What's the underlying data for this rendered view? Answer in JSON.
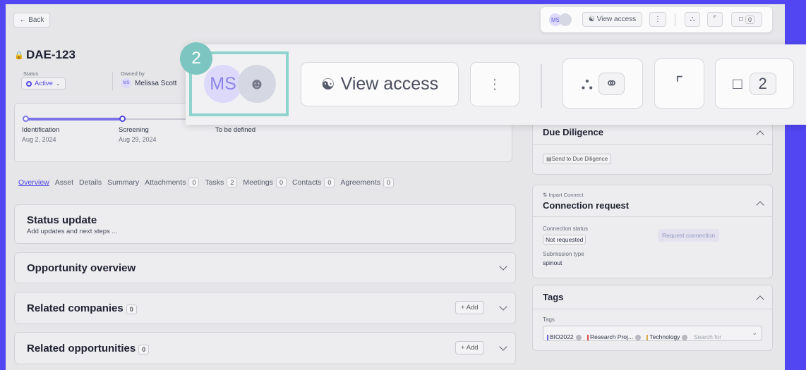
{
  "toolbar": {
    "back_label": "← Back",
    "avatar_initials": "MS",
    "view_access_label": "View access",
    "more_label": "⋮",
    "comment_count": "0"
  },
  "header": {
    "record_id": "DAE-123",
    "status_label": "Status",
    "status_value": "Active",
    "owner_label": "Owned by",
    "owner_initials": "MS",
    "owner_name": "Melissa Scott"
  },
  "timeline": {
    "stages": [
      {
        "name": "Identification",
        "date": "Aug 2, 2024"
      },
      {
        "name": "Screening",
        "date": "Aug 29, 2024"
      },
      {
        "name": "To be defined",
        "date": ""
      }
    ]
  },
  "tabs": [
    {
      "label": "Overview",
      "count": ""
    },
    {
      "label": "Asset",
      "count": ""
    },
    {
      "label": "Details",
      "count": ""
    },
    {
      "label": "Summary",
      "count": ""
    },
    {
      "label": "Attachments",
      "count": "0"
    },
    {
      "label": "Tasks",
      "count": "2"
    },
    {
      "label": "Meetings",
      "count": "0"
    },
    {
      "label": "Contacts",
      "count": "0"
    },
    {
      "label": "Agreements",
      "count": "0"
    }
  ],
  "main": {
    "status_update_title": "Status update",
    "status_update_sub": "Add updates and next steps ...",
    "opportunity_overview": "Opportunity overview",
    "related_companies": "Related companies",
    "related_companies_count": "0",
    "related_opportunities": "Related opportunities",
    "related_opportunities_count": "0",
    "add_label": "+ Add"
  },
  "side": {
    "due_diligence_title": "Due Diligence",
    "send_dd_label": "Send to Due Diligence",
    "inpart_label": "⇅ Inpart Connect",
    "connection_title": "Connection request",
    "connection_status_label": "Connection status",
    "connection_status_value": "Not requested",
    "request_connection_label": "Request connection",
    "submission_type_label": "Submission type",
    "submission_type_value": "spinout",
    "tags_title": "Tags",
    "tags_label": "Tags",
    "tags": [
      "BIO2022",
      "Research Proj...",
      "Technology"
    ],
    "tags_search_placeholder": "Search for"
  },
  "zoom": {
    "step_number": "2",
    "avatar_initials": "MS",
    "view_access_label": "View access",
    "more_label": "⋮",
    "comment_count": "2"
  },
  "colors": {
    "background": "#5146f2",
    "accent": "#4f46e5",
    "step_badge": "#7cc5c0"
  }
}
